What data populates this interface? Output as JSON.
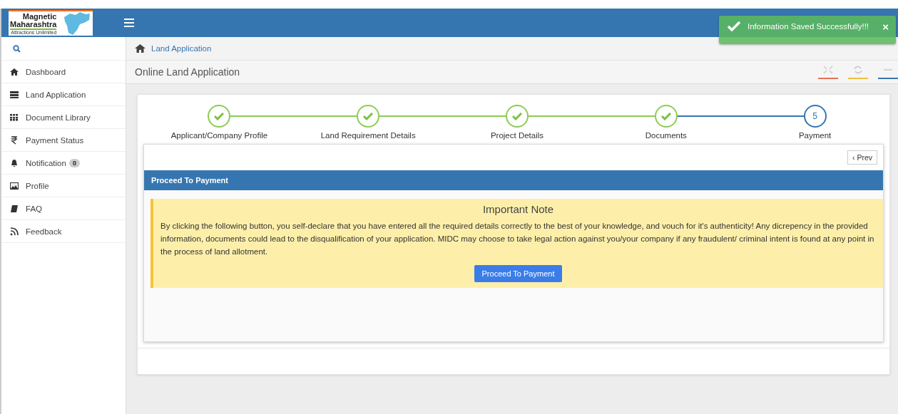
{
  "logo": {
    "line1": "Magnetic",
    "line2": "Maharashtra",
    "tagline": "Attractions Unlimited"
  },
  "toast": {
    "message": "Information Saved Successfully!!!",
    "close": "×"
  },
  "sidebar": {
    "items": [
      {
        "label": "Dashboard",
        "kind": "home"
      },
      {
        "label": "Land Application",
        "kind": "list"
      },
      {
        "label": "Document Library",
        "kind": "grid"
      },
      {
        "label": "Payment Status",
        "kind": "rupee"
      },
      {
        "label": "Notification",
        "kind": "bell",
        "badge": "0"
      },
      {
        "label": "Profile",
        "kind": "image"
      },
      {
        "label": "FAQ",
        "kind": "book"
      },
      {
        "label": "Feedback",
        "kind": "rss"
      }
    ]
  },
  "breadcrumb": "Land Application",
  "page_title": "Online Land Application",
  "steps": [
    {
      "label": "Applicant/Company Profile",
      "done": true
    },
    {
      "label": "Land Requirement Details",
      "done": true
    },
    {
      "label": "Project Details",
      "done": true
    },
    {
      "label": "Documents",
      "done": true
    },
    {
      "label": "Payment",
      "done": false,
      "number": "5"
    }
  ],
  "prev_button": "‹ Prev",
  "panel": {
    "title": "Proceed To Payment",
    "note_title": "Important Note",
    "note_text": "By clicking the following button, you self-declare that you have entered all the required details correctly to the best of your knowledge, and vouch for it's authenticity! Any dicrepency in the provided information, documents could lead to the disqualification of your application. MIDC may choose to take legal action against you/your company if any fraudulent/ criminal intent is found at any point in the process of land allotment.",
    "button": "Proceed To Payment"
  }
}
